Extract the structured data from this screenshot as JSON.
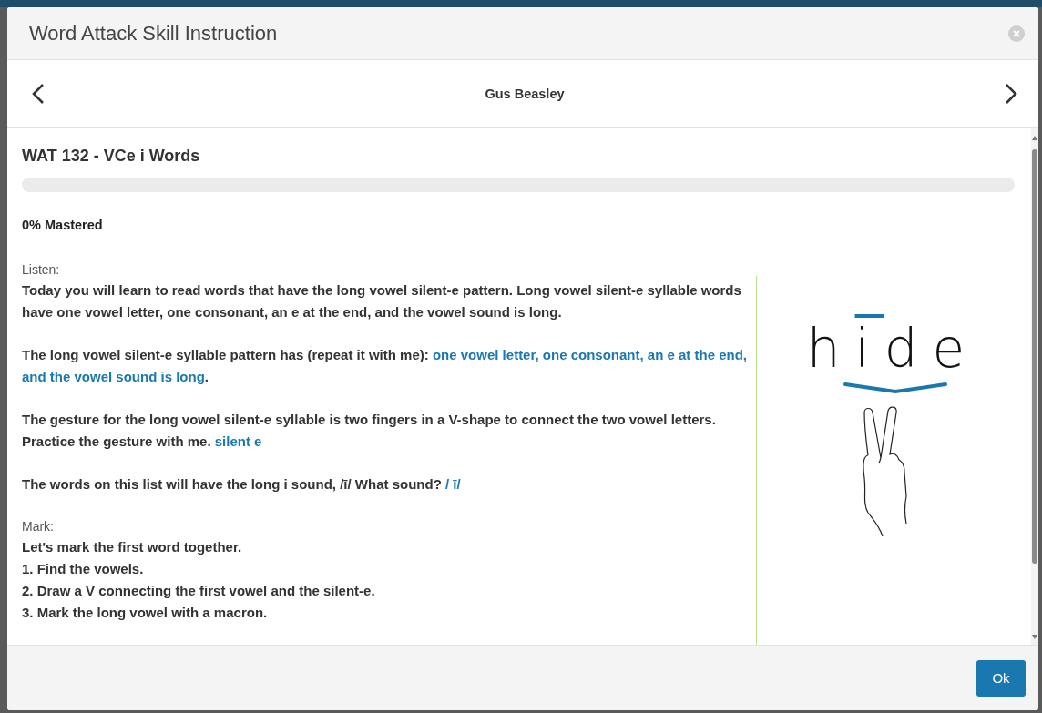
{
  "window": {
    "title": "Word Attack Skill Instruction"
  },
  "navigator": {
    "student": "Gus Beasley"
  },
  "lesson": {
    "title": "WAT 132 - VCe i Words",
    "mastery": {
      "level": 0
    },
    "mastered_text": "0% Mastered"
  },
  "sections": [
    {
      "label": "Listen:",
      "blocks": [
        {
          "lines": [
            [
              {
                "text": "Today you will learn to read words that have the long vowel silent-e pattern. Long vowel silent-e syllable words have one vowel letter, one consonant, an e at the end, and the vowel sound is long.",
                "highlight": false
              }
            ]
          ]
        },
        {
          "lines": [
            [
              {
                "text": "The long vowel silent-e syllable pattern has (repeat it with me): ",
                "highlight": false
              },
              {
                "text": "one vowel letter, one consonant, an e at the end, and the vowel sound is long",
                "highlight": true
              },
              {
                "text": ".",
                "highlight": false
              }
            ]
          ]
        },
        {
          "lines": [
            [
              {
                "text": "The gesture for the long vowel silent-e syllable is two fingers in a V-shape to connect the two vowel letters. Practice the gesture with me. ",
                "highlight": false
              },
              {
                "text": "silent e",
                "highlight": true
              }
            ]
          ]
        },
        {
          "lines": [
            [
              {
                "text": "The words on this list will have the long i sound, /ī/ What sound? ",
                "highlight": false
              },
              {
                "text": "/ ī/",
                "highlight": true
              }
            ]
          ]
        }
      ]
    },
    {
      "label": "Mark:",
      "blocks": [
        {
          "lines": [
            [
              {
                "text": "Let's mark the first word together.",
                "highlight": false
              }
            ],
            [
              {
                "text": "1. Find the vowels.",
                "highlight": false
              }
            ],
            [
              {
                "text": "2. Draw a V connecting the first vowel and the silent-e.",
                "highlight": false
              }
            ],
            [
              {
                "text": "3. Mark the long vowel with a macron.",
                "highlight": false
              }
            ]
          ]
        }
      ]
    }
  ],
  "illustration": {
    "letters": [
      {
        "char": "h",
        "macron": false
      },
      {
        "char": "i",
        "macron": true
      },
      {
        "char": "d",
        "macron": false
      },
      {
        "char": "e",
        "macron": false
      }
    ]
  },
  "buttons": [
    {
      "label": "Ok"
    }
  ]
}
